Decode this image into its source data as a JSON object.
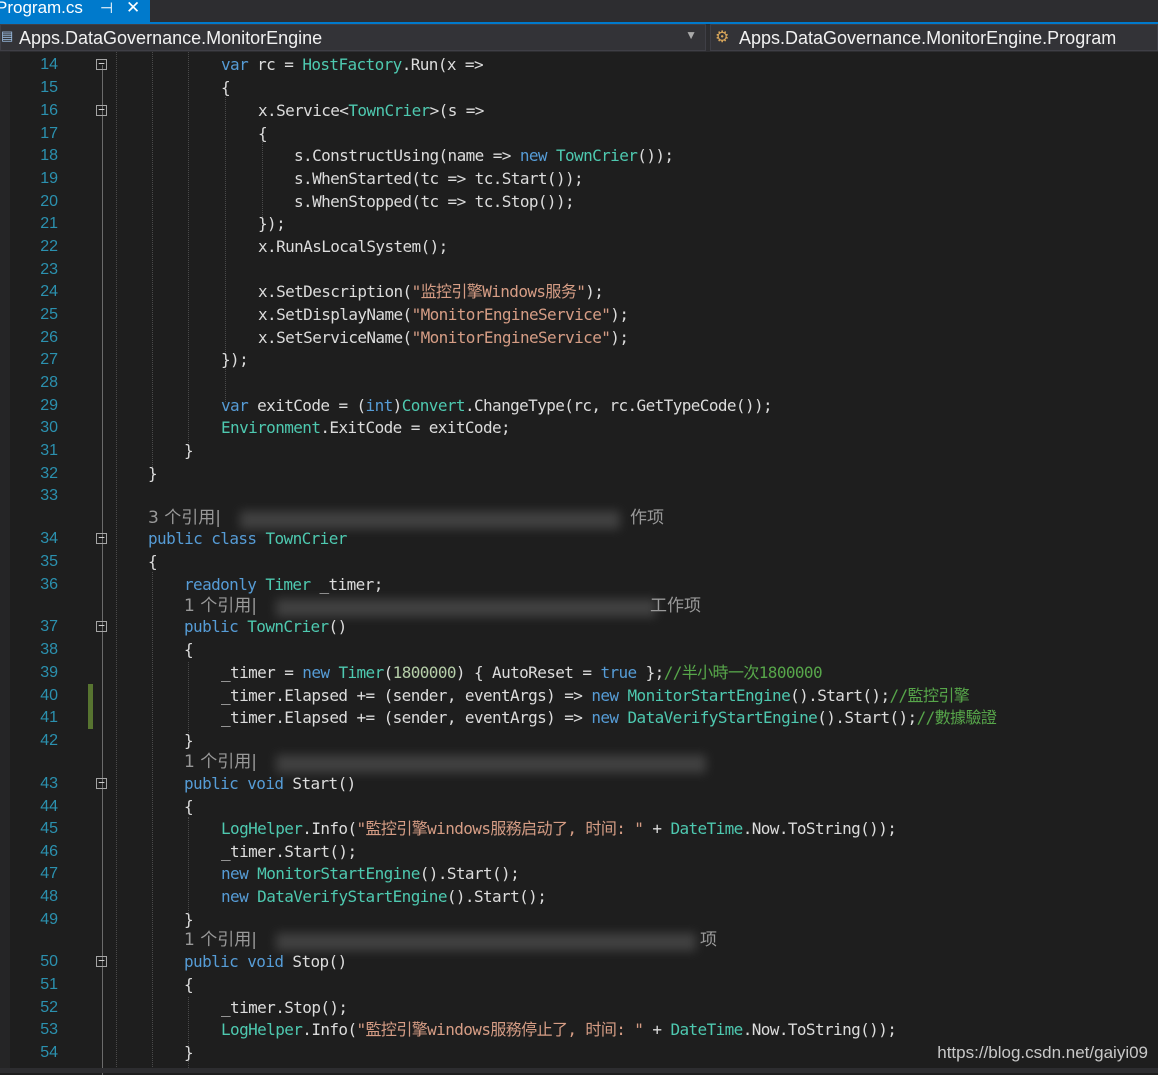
{
  "tab": {
    "file_name": "Program.cs",
    "pin_glyph": "⊣",
    "close_glyph": "✕"
  },
  "nav": {
    "namespace": "Apps.DataGovernance.MonitorEngine",
    "member": "Apps.DataGovernance.MonitorEngine.Program"
  },
  "refs": {
    "r1": "3 个引用|",
    "r2": "1 个引用|",
    "r3": "1 个引用|",
    "r4": "1 个引用|",
    "r1_tail": "作项",
    "r2_tail": "工作项",
    "r4_tail": "项"
  },
  "lines": {
    "n14": "14",
    "n15": "15",
    "n16": "16",
    "n17": "17",
    "n18": "18",
    "n19": "19",
    "n20": "20",
    "n21": "21",
    "n22": "22",
    "n23": "23",
    "n24": "24",
    "n25": "25",
    "n26": "26",
    "n27": "27",
    "n28": "28",
    "n29": "29",
    "n30": "30",
    "n31": "31",
    "n32": "32",
    "n33": "33",
    "n34": "34",
    "n35": "35",
    "n36": "36",
    "n37": "37",
    "n38": "38",
    "n39": "39",
    "n40": "40",
    "n41": "41",
    "n42": "42",
    "n43": "43",
    "n44": "44",
    "n45": "45",
    "n46": "46",
    "n47": "47",
    "n48": "48",
    "n49": "49",
    "n50": "50",
    "n51": "51",
    "n52": "52",
    "n53": "53",
    "n54": "54"
  },
  "code": {
    "c14": [
      "var",
      " rc = ",
      "HostFactory",
      ".Run(x =>"
    ],
    "c15": "{",
    "c16": [
      "x.Service<",
      "TownCrier",
      ">(s =>"
    ],
    "c17": "{",
    "c18": [
      "s.ConstructUsing(name => ",
      "new",
      " ",
      "TownCrier",
      "());"
    ],
    "c19": "s.WhenStarted(tc => tc.Start());",
    "c20": "s.WhenStopped(tc => tc.Stop());",
    "c21": "});",
    "c22": "x.RunAsLocalSystem();",
    "c24": [
      "x.SetDescription(",
      "\"监控引擎Windows服务\"",
      ");"
    ],
    "c25": [
      "x.SetDisplayName(",
      "\"MonitorEngineService\"",
      ");"
    ],
    "c26": [
      "x.SetServiceName(",
      "\"MonitorEngineService\"",
      ");"
    ],
    "c27": "});",
    "c29": [
      "var",
      " exitCode = (",
      "int",
      ")",
      "Convert",
      ".ChangeType(rc, rc.GetTypeCode());"
    ],
    "c30": [
      "Environment",
      ".ExitCode = exitCode;"
    ],
    "c31": "}",
    "c32": "}",
    "c34": [
      "public",
      " ",
      "class",
      " ",
      "TownCrier"
    ],
    "c35": "{",
    "c36": [
      "readonly",
      " ",
      "Timer",
      " _timer;"
    ],
    "c37": [
      "public",
      " ",
      "TownCrier",
      "()"
    ],
    "c38": "{",
    "c39": [
      "_timer = ",
      "new",
      " ",
      "Timer",
      "(",
      "1800000",
      ") { AutoReset = ",
      "true",
      " };",
      "//半小時一次1800000"
    ],
    "c40": [
      "_timer.Elapsed += (sender, eventArgs) => ",
      "new",
      " ",
      "MonitorStartEngine",
      "().Start();",
      "//監控引擎"
    ],
    "c41": [
      "_timer.Elapsed += (sender, eventArgs) => ",
      "new",
      " ",
      "DataVerifyStartEngine",
      "().Start();",
      "//數據驗證"
    ],
    "c42": "}",
    "c43": [
      "public",
      " ",
      "void",
      " Start()"
    ],
    "c44": "{",
    "c45": [
      "LogHelper",
      ".Info(",
      "\"監控引擎windows服務启动了, 时间: \"",
      " + ",
      "DateTime",
      ".Now.ToString());"
    ],
    "c46": "_timer.Start();",
    "c47": [
      "new",
      " ",
      "MonitorStartEngine",
      "().Start();"
    ],
    "c48": [
      "new",
      " ",
      "DataVerifyStartEngine",
      "().Start();"
    ],
    "c49": "}",
    "c50": [
      "public",
      " ",
      "void",
      " Stop()"
    ],
    "c51": "{",
    "c52": "_timer.Stop();",
    "c53": [
      "LogHelper",
      ".Info(",
      "\"監控引擎windows服務停止了, 时间: \"",
      " + ",
      "DateTime",
      ".Now.ToString());"
    ],
    "c54": "}"
  },
  "watermark": "https://blog.csdn.net/gaiyi09",
  "colors": {
    "keyword": "#569cd6",
    "type": "#4ec9b0",
    "string": "#d69d85",
    "number": "#b5cea8",
    "comment": "#57a64a",
    "line_number": "#2b91af",
    "accent": "#007acc"
  }
}
